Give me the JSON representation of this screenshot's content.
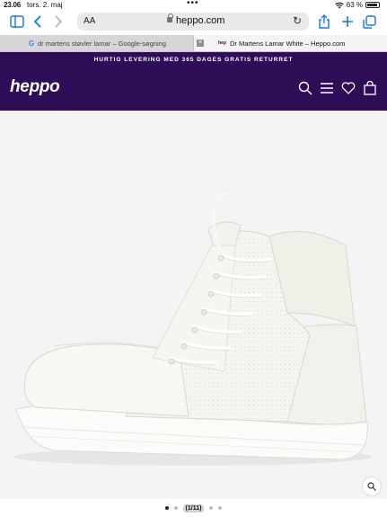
{
  "status_bar": {
    "time": "23.06",
    "date": "tors. 2. maj",
    "battery": "63 %"
  },
  "browser": {
    "text_size_label": "AA",
    "url": "heppo.com",
    "tabs": [
      {
        "label": "dr martens støvler lamar – Google-søgning",
        "active": false
      },
      {
        "label": "Dr Martens Lamar White – Heppo.com",
        "active": true
      }
    ]
  },
  "site": {
    "promo": "HURTIG LEVERING MED 365 DAGES GRATIS RETURRET",
    "logo": "heppo",
    "brand_color": "#2c0d56",
    "nav_icons": [
      "search-icon",
      "menu-icon",
      "heart-icon",
      "bag-icon"
    ]
  },
  "gallery": {
    "counter": "(1/11)",
    "current": 1,
    "total": 11
  }
}
